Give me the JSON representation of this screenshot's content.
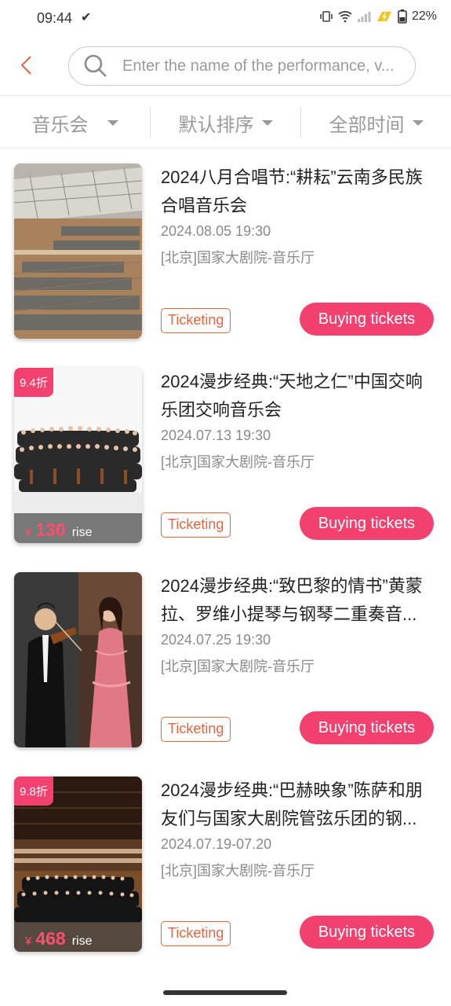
{
  "status_bar": {
    "time": "09:44",
    "check": "✔",
    "battery": "22%"
  },
  "search": {
    "placeholder": "Enter the name of the performance, v..."
  },
  "filters": [
    {
      "label": "音乐会"
    },
    {
      "label": "默认排序"
    },
    {
      "label": "全部时间"
    }
  ],
  "items": [
    {
      "title": "2024八月合唱节:“耕耘”云南多民族合唱音乐会",
      "date": "2024.08.05  19:30",
      "venue": "[北京]国家大剧院-音乐厅",
      "status": "Ticketing",
      "button": "Buying tickets",
      "discount": null,
      "price": null
    },
    {
      "title": "2024漫步经典:“天地之仁”中国交响乐团交响音乐会",
      "date": "2024.07.13  19:30",
      "venue": "[北京]国家大剧院-音乐厅",
      "status": "Ticketing",
      "button": "Buying tickets",
      "discount": "9.4折",
      "price": {
        "currency": "¥",
        "value": "130",
        "suffix": "rise"
      }
    },
    {
      "title": "2024漫步经典:“致巴黎的情书”黄蒙拉、罗维小提琴与钢琴二重奏音...",
      "date": "2024.07.25  19:30",
      "venue": "[北京]国家大剧院-音乐厅",
      "status": "Ticketing",
      "button": "Buying tickets",
      "discount": null,
      "price": null
    },
    {
      "title": "2024漫步经典:“巴赫映象”陈萨和朋友们与国家大剧院管弦乐团的钢...",
      "date": "2024.07.19-07.20",
      "venue": "[北京]国家大剧院-音乐厅",
      "status": "Ticketing",
      "button": "Buying tickets",
      "discount": "9.8折",
      "price": {
        "currency": "¥",
        "value": "468",
        "suffix": "rise"
      }
    }
  ],
  "colors": {
    "accent": "#f2416e",
    "status_tag": "#e8633c",
    "back_arrow": "#e8633c"
  }
}
